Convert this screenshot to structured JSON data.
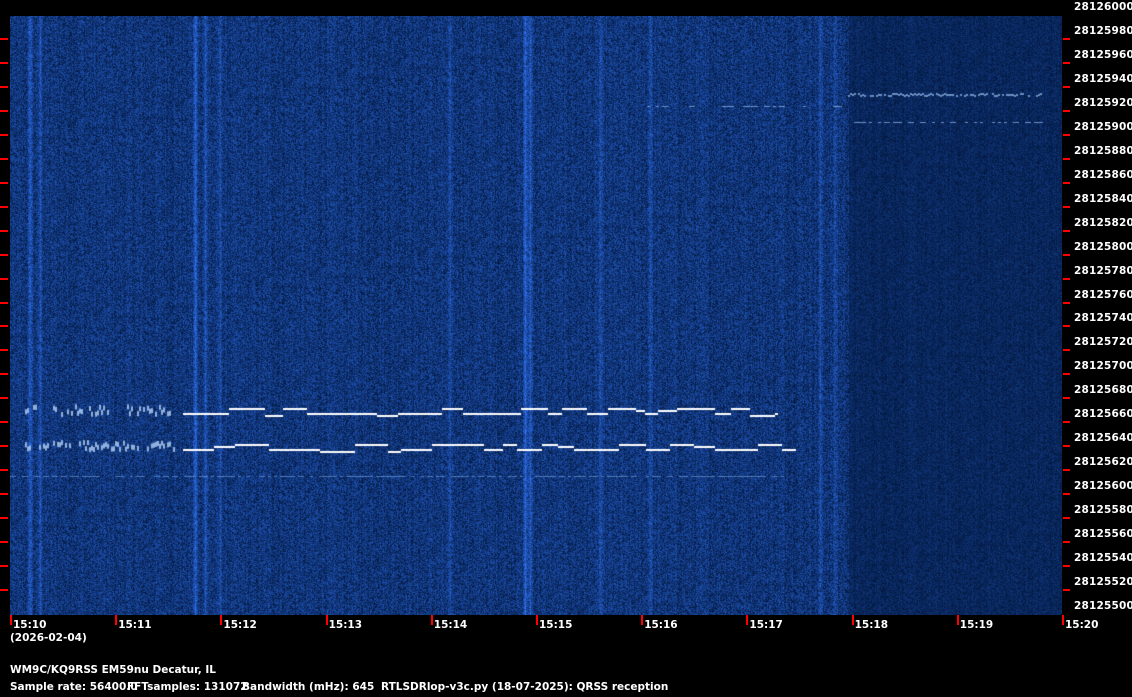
{
  "frequency_axis": [
    "28126000",
    "28125980",
    "28125960",
    "28125940",
    "28125920",
    "28125900",
    "28125880",
    "28125860",
    "28125840",
    "28125820",
    "28125800",
    "28125780",
    "28125760",
    "28125740",
    "28125720",
    "28125700",
    "28125680",
    "28125660",
    "28125640",
    "28125620",
    "28125600",
    "28125580",
    "28125560",
    "28125540",
    "28125520",
    "28125500"
  ],
  "time_axis": [
    "15:10",
    "15:11",
    "15:12",
    "15:13",
    "15:14",
    "15:15",
    "15:16",
    "15:17",
    "15:18",
    "15:19",
    "15:20"
  ],
  "date": "(2026-02-04)",
  "station": "WM9C/KQ9RSS EM59nu Decatur, IL",
  "sample_rate": "Sample rate: 56400.0",
  "fft_samples": "FFTsamples: 131072",
  "bandwidth": "Bandwidth (mHz): 645",
  "software": "RTLSDRlop-v3c.py (18-07-2025): QRSS reception",
  "colors": {
    "background": "#000000",
    "spectrogram": "#0a1a4a",
    "trace": "#ffffff",
    "tick": "#ff0000"
  }
}
